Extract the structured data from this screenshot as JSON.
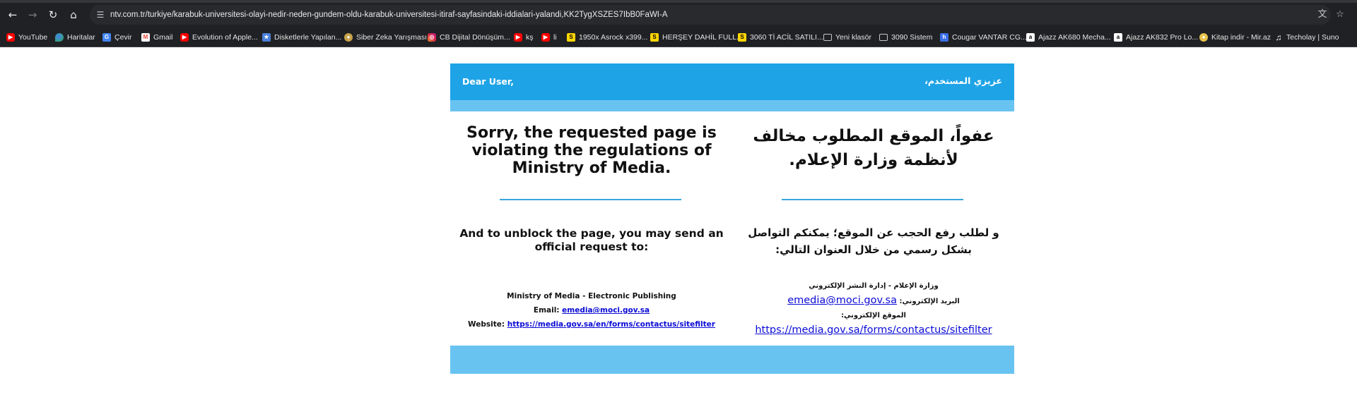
{
  "browser": {
    "url": "ntv.com.tr/turkiye/karabuk-universitesi-olayi-nedir-neden-gundem-oldu-karabuk-universitesi-itiraf-sayfasindaki-iddialari-yalandi,KK2TygXSZES7IbB0FaWI-A",
    "nav": {
      "back": "←",
      "forward": "→",
      "reload": "↻",
      "home": "⌂"
    },
    "icons": {
      "tune": "☰",
      "translate": "文",
      "bookmark_star": "☆"
    },
    "bookmarks": [
      {
        "label": "YouTube",
        "icon": "youtube-icon",
        "glyph": "▶"
      },
      {
        "label": "Haritalar",
        "icon": "maps-icon",
        "glyph": ""
      },
      {
        "label": "Çevir",
        "icon": "translate-icon",
        "glyph": "G"
      },
      {
        "label": "Gmail",
        "icon": "gmail-icon",
        "glyph": "M"
      },
      {
        "label": "Evolution of Apple...",
        "icon": "youtube-icon",
        "glyph": "▶"
      },
      {
        "label": "Disketlerle Yapılan...",
        "icon": "site-icon",
        "glyph": "★"
      },
      {
        "label": "Siber Zeka Yarışması",
        "icon": "site-icon",
        "glyph": "●"
      },
      {
        "label": "CB Dijital Dönüşüm...",
        "icon": "instagram-icon",
        "glyph": "◎"
      },
      {
        "label": "kş",
        "icon": "youtube-icon",
        "glyph": "▶"
      },
      {
        "label": "li",
        "icon": "youtube-icon",
        "glyph": "▶"
      },
      {
        "label": "1950x Asrock x399...",
        "icon": "sahibinden-icon",
        "glyph": "S"
      },
      {
        "label": "HERŞEY DAHİL FULL...",
        "icon": "sahibinden-icon",
        "glyph": "S"
      },
      {
        "label": "3060 Tİ ACİL SATILI...",
        "icon": "sahibinden-icon",
        "glyph": "S"
      },
      {
        "label": "Yeni klasör",
        "icon": "folder-icon",
        "glyph": ""
      },
      {
        "label": "3090 Sistem",
        "icon": "folder-icon",
        "glyph": ""
      },
      {
        "label": "Cougar VANTAR CG...",
        "icon": "site-icon",
        "glyph": "h"
      },
      {
        "label": "Ajazz AK680 Mecha...",
        "icon": "amazon-icon",
        "glyph": "a"
      },
      {
        "label": "Ajazz AK832 Pro Lo...",
        "icon": "amazon-icon",
        "glyph": "a"
      },
      {
        "label": "Kitap indir - Mir.az",
        "icon": "site-icon",
        "glyph": "●"
      },
      {
        "label": "Techolay | Suno",
        "icon": "suno-icon",
        "glyph": "♫"
      }
    ]
  },
  "notice": {
    "header_en": "Dear User,",
    "header_ar": "عزيزي المستخدم،",
    "title_en": "Sorry, the requested page is violating the regulations of Ministry of Media.",
    "title_ar": "عفواً، الموقع المطلوب مخالف لأنظمة وزارة الإعلام.",
    "request_en": "And to unblock the page, you may send an official request to:",
    "request_ar": "و لطلب رفع الحجب عن الموقع؛ يمكنكم التواصل بشكل رسمي من خلال العنوان التالي:",
    "contact_en": {
      "org": "Ministry of Media - Electronic Publishing",
      "email_label": "Email:",
      "email": "emedia@moci.gov.sa",
      "website_label": "Website:",
      "website": "https://media.gov.sa/en/forms/contactus/sitefilter"
    },
    "contact_ar": {
      "org": "وزارة الإعلام - إدارة النشر الإلكتروني",
      "email_label": "البريد الإلكتروني:",
      "email": "emedia@moci.gov.sa",
      "website_label": "الموقع الإلكتروني:",
      "website": "https://media.gov.sa/forms/contactus/sitefilter"
    }
  },
  "colors": {
    "header_blue": "#1ea3e6",
    "band_light_blue": "#69c3f1",
    "divider_blue": "#37a5dd",
    "link_blue": "#0b0bd6"
  }
}
